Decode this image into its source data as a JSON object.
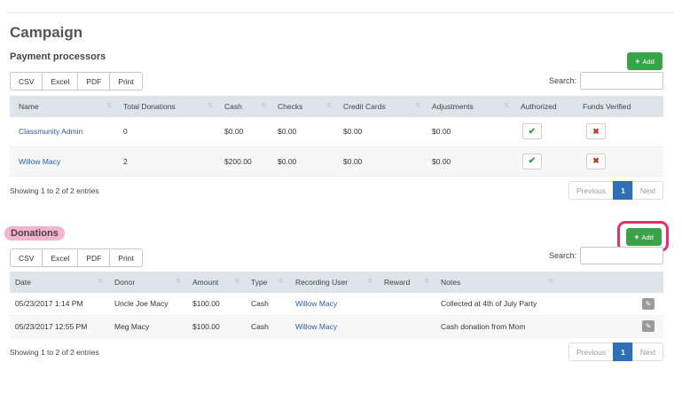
{
  "page": {
    "title": "Campaign"
  },
  "processors": {
    "title": "Payment processors",
    "add_label": "Add",
    "export_buttons": [
      "CSV",
      "Excel",
      "PDF",
      "Print"
    ],
    "search_label": "Search:",
    "search_value": "",
    "columns": [
      "Name",
      "Total Donations",
      "Cash",
      "Checks",
      "Credit Cards",
      "Adjustments",
      "Authorized",
      "Funds Verified"
    ],
    "rows": [
      {
        "name": "Classmunity Admin",
        "total": "0",
        "cash": "$0.00",
        "checks": "$0.00",
        "credit": "$0.00",
        "adjust": "$0.00",
        "authorized": "✔",
        "verified": "✖"
      },
      {
        "name": "Willow Macy",
        "total": "2",
        "cash": "$200.00",
        "checks": "$0.00",
        "credit": "$0.00",
        "adjust": "$0.00",
        "authorized": "✔",
        "verified": "✖"
      }
    ],
    "showing": "Showing 1 to 2 of 2 entries",
    "pager": {
      "prev": "Previous",
      "page": "1",
      "next": "Next"
    }
  },
  "donations": {
    "title": "Donations",
    "add_label": "Add",
    "export_buttons": [
      "CSV",
      "Excel",
      "PDF",
      "Print"
    ],
    "search_label": "Search:",
    "search_value": "",
    "columns": [
      "Date",
      "Donor",
      "Amount",
      "Type",
      "Recording User",
      "Reward",
      "Notes"
    ],
    "rows": [
      {
        "date": "05/23/2017 1:14 PM",
        "donor": "Uncle Joe Macy",
        "amount": "$100.00",
        "type": "Cash",
        "user": "Willow Macy",
        "reward": "",
        "notes": "Collected at 4th of July Party"
      },
      {
        "date": "05/23/2017 12:55 PM",
        "donor": "Meg Macy",
        "amount": "$100.00",
        "type": "Cash",
        "user": "Willow Macy",
        "reward": "",
        "notes": "Cash donation from Mom"
      }
    ],
    "showing": "Showing 1 to 2 of 2 entries",
    "pager": {
      "prev": "Previous",
      "page": "1",
      "next": "Next"
    }
  },
  "colors": {
    "accent_green": "#3aa34a",
    "link_blue": "#2a5d9f",
    "highlight_pink": "#e0316f",
    "header_bg": "#dde4ea"
  },
  "icons": {
    "add": "plus-icon",
    "authorized": "check-icon",
    "verified": "x-icon",
    "edit": "edit-icon",
    "sort": "sort-icon"
  }
}
